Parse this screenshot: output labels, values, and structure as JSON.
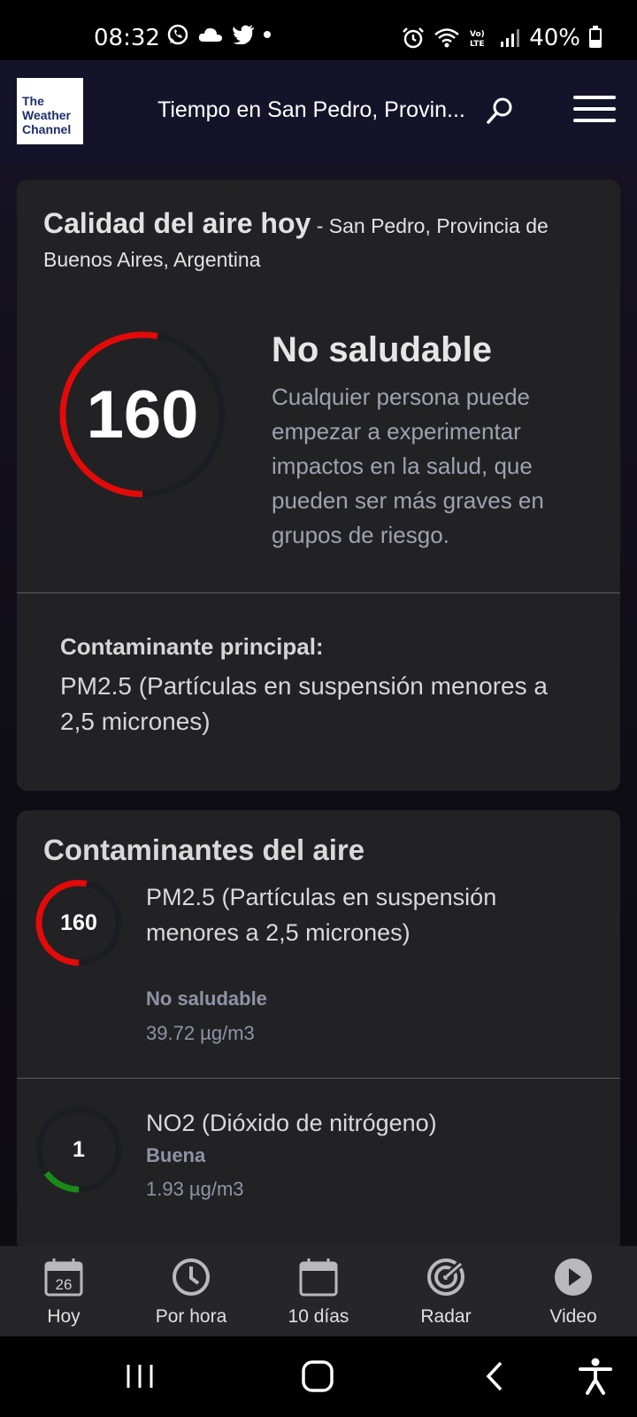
{
  "status_bar": {
    "time": "08:32",
    "battery": "40%",
    "battery_level": 0.4,
    "icons_left": [
      "whatsapp-icon",
      "cloud-icon",
      "twitter-icon",
      "dot-icon"
    ],
    "icons_right": [
      "alarm-icon",
      "wifi-icon",
      "volte-icon",
      "signal-icon",
      "battery-icon"
    ]
  },
  "header": {
    "logo_text": [
      "The",
      "Weather",
      "Channel"
    ],
    "location": "Tiempo en San Pedro, Provin...",
    "search_icon": "search-icon",
    "menu_icon": "hamburger-menu-icon"
  },
  "air_quality": {
    "title": "Calidad del aire hoy",
    "location": " - San Pedro, Provincia de Buenos Aires, Argentina",
    "index": "160",
    "index_fraction": 0.53,
    "status": "No saludable",
    "description": "Cualquier persona puede empezar a experimentar impactos en la salud, que pueden ser más graves en grupos de riesgo.",
    "principal_label": "Contaminante principal:",
    "principal_value": "PM2.5 (Partículas en suspensión menores a 2,5 micrones)",
    "status_color": "#e30a0a"
  },
  "pollutants": {
    "title": "Contaminantes del aire",
    "items": [
      {
        "index": "160",
        "fraction": 0.53,
        "color": "#e30a0a",
        "name": "PM2.5 (Partículas en suspensión menores a 2,5 micrones)",
        "status": "No saludable",
        "concentration": "39.72 µg/m3"
      },
      {
        "index": "1",
        "fraction": 0.15,
        "color": "#1a8a1a",
        "name": "NO2 (Dióxido de nitrógeno)",
        "status": "Buena",
        "concentration": "1.93 µg/m3"
      }
    ]
  },
  "bottom_nav": [
    {
      "label": "Hoy",
      "icon": "calendar-today-icon",
      "day": "26"
    },
    {
      "label": "Por hora",
      "icon": "clock-icon"
    },
    {
      "label": "10 días",
      "icon": "calendar-icon"
    },
    {
      "label": "Radar",
      "icon": "radar-icon"
    },
    {
      "label": "Video",
      "icon": "play-icon"
    }
  ],
  "system_nav": [
    "recents-icon",
    "home-icon",
    "back-icon",
    "accessibility-icon"
  ]
}
